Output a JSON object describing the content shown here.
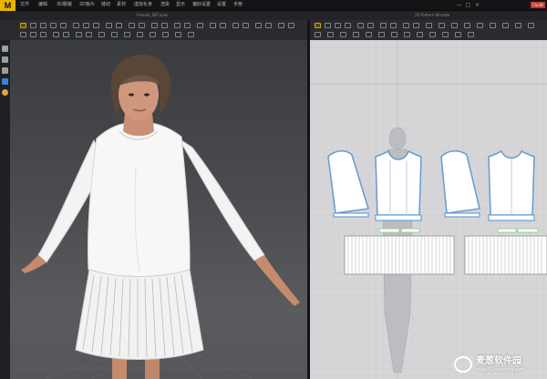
{
  "app": {
    "logo": "M"
  },
  "menu": {
    "items": [
      "文件",
      "编辑",
      "3D服装",
      "2D板片",
      "缝纫",
      "素材",
      "虚拟化身",
      "渲染",
      "显示",
      "偏好设置",
      "设置",
      "手册"
    ]
  },
  "window": {
    "brand": "Clo3D",
    "minimize": "—",
    "maximize": "□",
    "close": "×"
  },
  "tabs": {
    "viewport3d_title": "Female_SBT.zpac",
    "viewport2d_title": "2D Pattern Window"
  },
  "watermark": {
    "title": "麦葱软件园",
    "url": "www.52maicong.com"
  },
  "colors": {
    "accent": "#e6b400",
    "pattern_fill": "#ffffff",
    "pattern_outline": "#6a9fd0",
    "pattern_bg": "#d6d6d8"
  },
  "icons": {
    "rail": [
      "select-icon",
      "move-icon",
      "transform-icon",
      "avatar-icon",
      "light-icon"
    ]
  }
}
